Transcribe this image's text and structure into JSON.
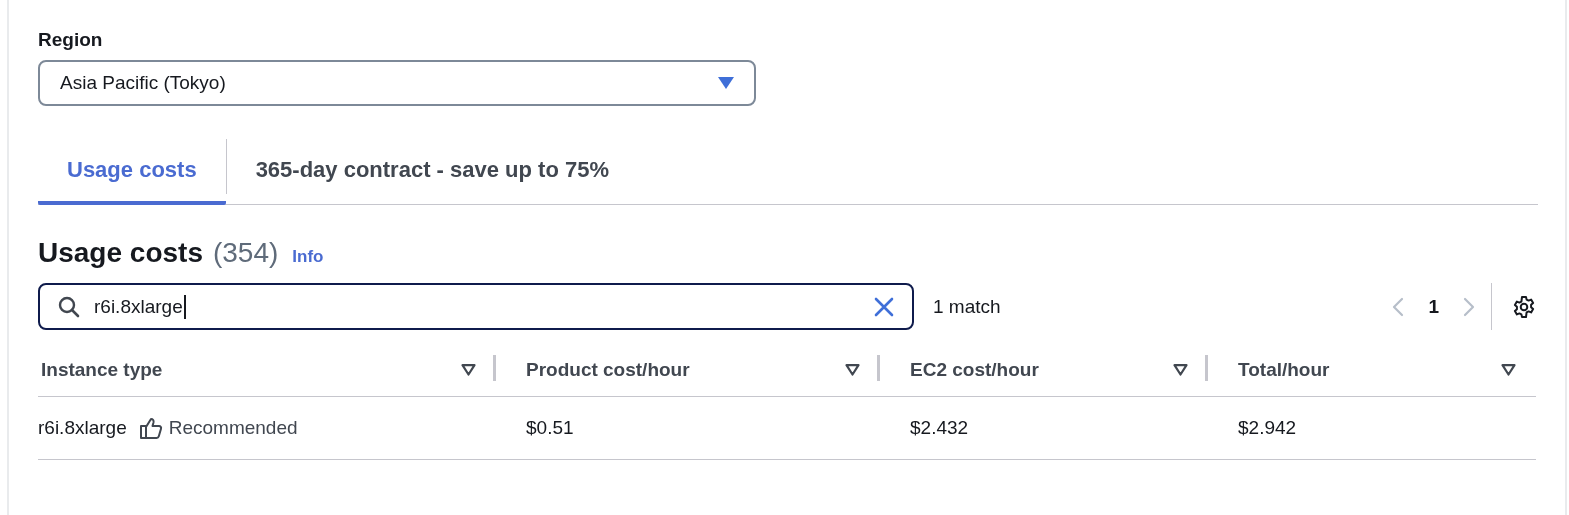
{
  "region": {
    "label": "Region",
    "value": "Asia Pacific (Tokyo)"
  },
  "tabs": [
    {
      "label": "Usage costs",
      "selected": true
    },
    {
      "label": "365-day contract - save up to 75%",
      "selected": false
    }
  ],
  "table_header": {
    "title": "Usage costs",
    "count": "(354)",
    "info_link": "Info"
  },
  "search": {
    "value": "r6i.8xlarge",
    "match_count": "1 match"
  },
  "pagination": {
    "previous_disabled": true,
    "next_disabled": true,
    "pages": [
      {
        "label": "1",
        "selected": true
      }
    ]
  },
  "table": {
    "columns": [
      "Instance type",
      "Product cost/hour",
      "EC2 cost/hour",
      "Total/hour"
    ],
    "rows": [
      {
        "instance_type": "r6i.8xlarge",
        "badge": "Recommended",
        "product_cost": "$0.51",
        "ec2_cost": "$2.432",
        "total": "$2.942"
      }
    ]
  }
}
